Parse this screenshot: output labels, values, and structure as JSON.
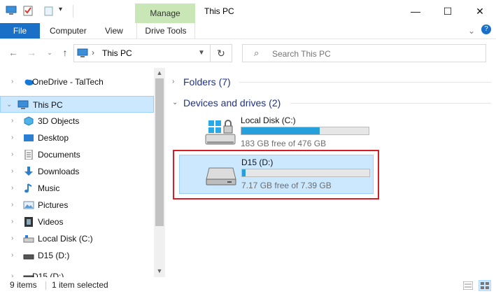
{
  "window": {
    "title": "This PC",
    "context_tab": "Manage",
    "minimize": "—",
    "maximize": "☐",
    "close": "✕"
  },
  "ribbon": {
    "tabs": [
      "File",
      "Computer",
      "View",
      "Drive Tools"
    ],
    "collapse": "⌄",
    "help": "?"
  },
  "address": {
    "path": "This PC",
    "separator": "›"
  },
  "search": {
    "placeholder": "Search This PC"
  },
  "sidebar": {
    "items": [
      {
        "label": "OneDrive - TalTech",
        "icon": "cloud-icon",
        "expanded": false
      },
      {
        "label": "This PC",
        "icon": "computer-icon",
        "expanded": true,
        "selected": true
      },
      {
        "label": "3D Objects",
        "icon": "cube-icon"
      },
      {
        "label": "Desktop",
        "icon": "desktop-folder-icon"
      },
      {
        "label": "Documents",
        "icon": "documents-icon"
      },
      {
        "label": "Downloads",
        "icon": "download-arrow-icon"
      },
      {
        "label": "Music",
        "icon": "music-note-icon"
      },
      {
        "label": "Pictures",
        "icon": "pictures-icon"
      },
      {
        "label": "Videos",
        "icon": "film-icon"
      },
      {
        "label": "Local Disk (C:)",
        "icon": "drive-icon"
      },
      {
        "label": "D15 (D:)",
        "icon": "drive-icon"
      },
      {
        "label": "D15 (D:)",
        "icon": "drive-icon"
      }
    ]
  },
  "content": {
    "folders_header": "Folders (7)",
    "devices_header": "Devices and drives (2)",
    "drives": [
      {
        "name": "Local Disk (C:)",
        "free": "183 GB free of 476 GB",
        "used_fraction": 0.615,
        "icon": "windows-drive-icon"
      },
      {
        "name": "D15 (D:)",
        "free": "7.17 GB free of 7.39 GB",
        "used_fraction": 0.03,
        "icon": "removable-drive-icon",
        "selected": true
      }
    ]
  },
  "status": {
    "items": "9 items",
    "selected": "1 item selected"
  },
  "colors": {
    "accent": "#1a6fc6",
    "context_tab": "#c8e6b6",
    "selection": "#cce8ff",
    "usage_bar": "#26a0da",
    "highlight_box": "#d41f26",
    "group_header": "#1e3287"
  }
}
